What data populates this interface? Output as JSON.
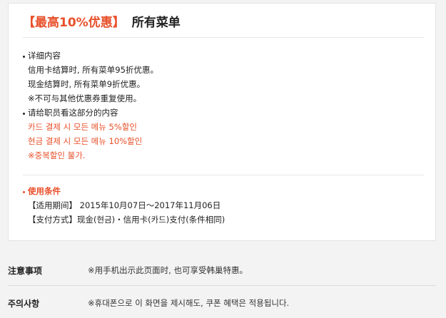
{
  "coupon": {
    "promo_tag": "【最高10%优惠】",
    "title": "所有菜单",
    "details_heading": "详细内容",
    "details_lines": [
      "信用卡结算时, 所有菜单95折优惠。",
      "现金结算时, 所有菜单9折优惠。",
      "※不可与其他优惠券重复使用。"
    ],
    "staff_heading": "请给职员看这部分的内容",
    "staff_lines": [
      "카드 결제 시 모든 메뉴 5%할인",
      "현금 결제 시 모든 메뉴 10%할인",
      "※중복할인 불가."
    ],
    "conditions_heading": "使用条件",
    "period": "【适用期间】 2015年10月07日～2017年11月06日",
    "payment": "【支付方式】现金(현금)・信用卡(카드)支付(条件相同)"
  },
  "notes": [
    {
      "label": "注意事项",
      "value": "※用手机出示此页面时, 也可享受韩巢特惠。"
    },
    {
      "label": "주의사항",
      "value": "※휴대폰으로 이 화면을 제시해도, 쿠폰 혜택은 적용됩니다."
    }
  ],
  "colors": {
    "accent": "#e8502a",
    "text": "#222222",
    "background": "#f3f3f3"
  }
}
